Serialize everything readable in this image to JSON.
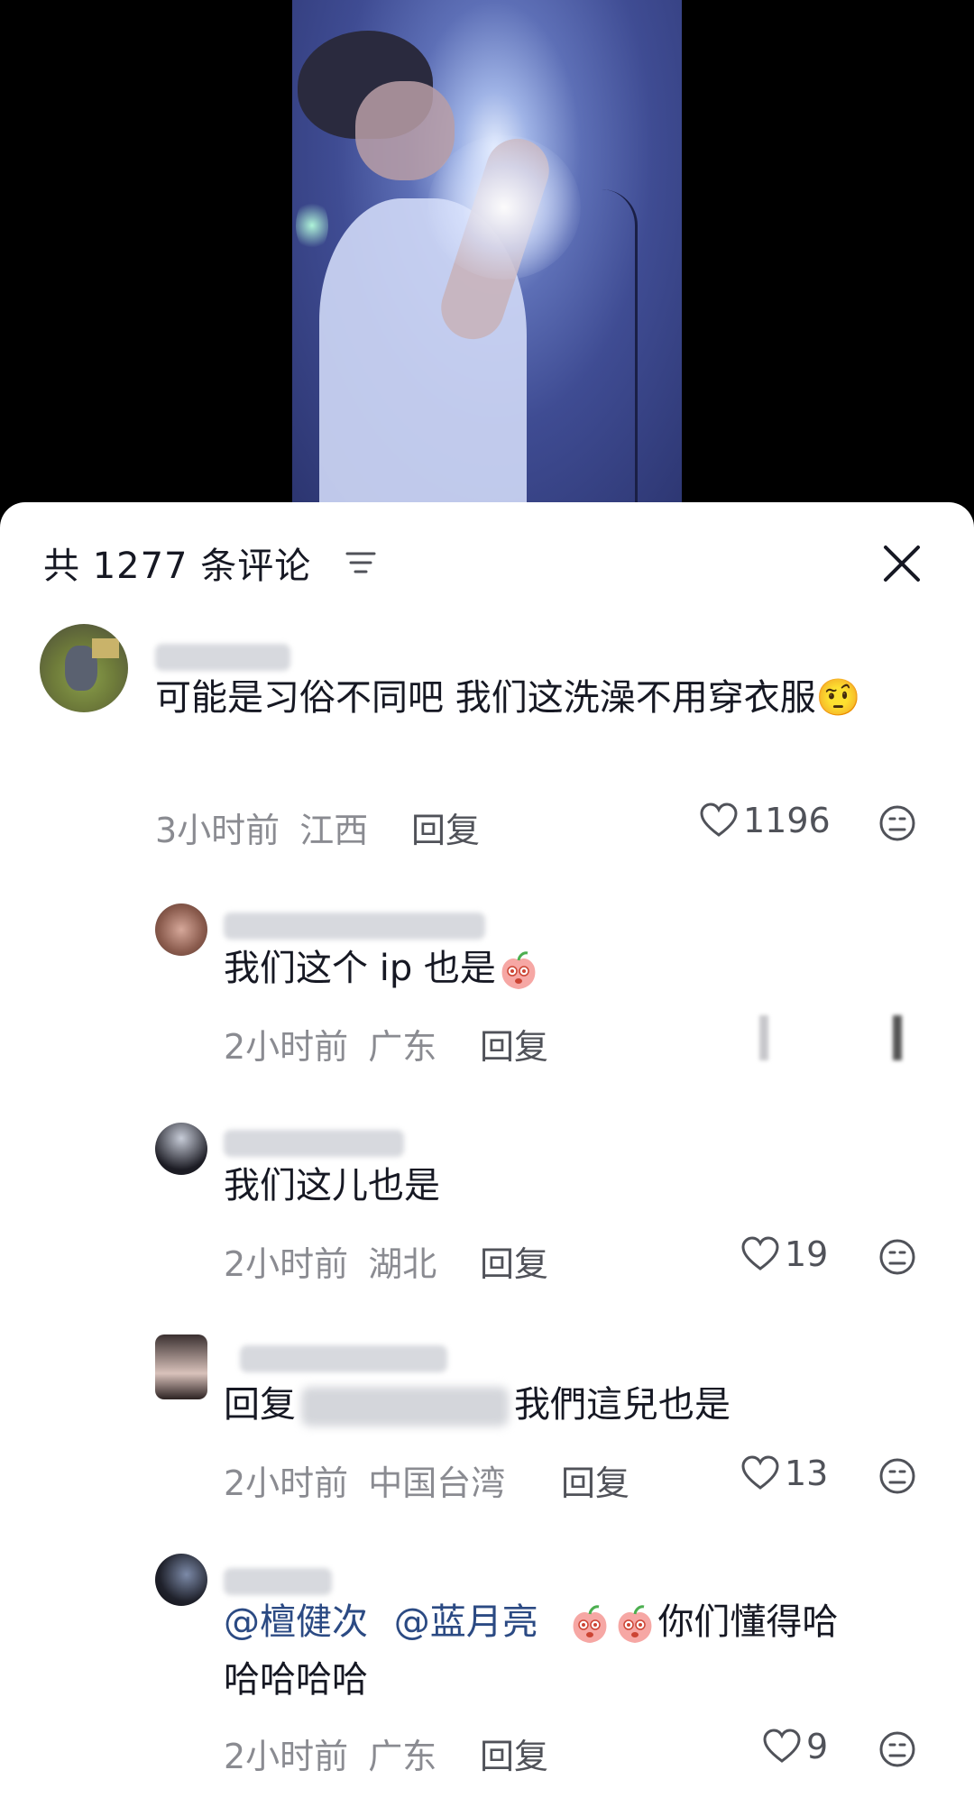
{
  "header": {
    "title": "共 1277 条评论"
  },
  "comments": [
    {
      "text": "可能是习俗不同吧 我们这洗澡不用穿衣服🤨",
      "time": "3小时前",
      "location": "江西",
      "reply_label": "回复",
      "likes": "1196"
    },
    {
      "text": "我们这个 ip 也是",
      "time": "2小时前",
      "location": "广东",
      "reply_label": "回复",
      "likes": ""
    },
    {
      "text": "我们这儿也是",
      "time": "2小时前",
      "location": "湖北",
      "reply_label": "回复",
      "likes": "19"
    },
    {
      "text_prefix": "回复",
      "text_suffix": "我們這兒也是",
      "time": "2小时前",
      "location": "中国台湾",
      "reply_label": "回复",
      "likes": "13"
    },
    {
      "mention1": "@檀健次",
      "mention2": "@蓝月亮",
      "text_line1": "你们懂得哈",
      "text_line2": "哈哈哈哈",
      "time": "2小时前",
      "location": "广东",
      "reply_label": "回复",
      "likes": "9"
    }
  ]
}
